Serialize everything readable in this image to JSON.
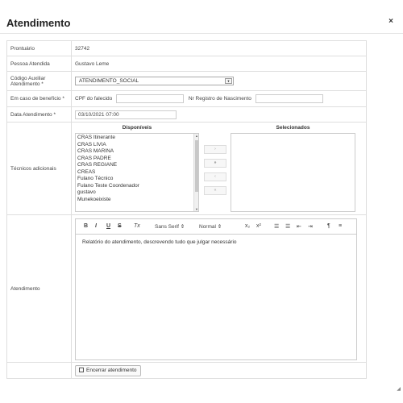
{
  "modal": {
    "title": "Atendimento",
    "close": "×"
  },
  "rows": {
    "prontuario": {
      "label": "Prontuário",
      "value": "32742"
    },
    "pessoa": {
      "label": "Pessoa Atendida",
      "value": "Gustavo Leme"
    },
    "codigo": {
      "label": "Código Auxiliar Atendimento *",
      "value": "ATENDIMENTO_SOCIAL"
    },
    "beneficio": {
      "label": "Em caso de benefício *",
      "cpf_label": "CPF do falecido",
      "cpf_value": "",
      "registro_label": "Nr Registro de Nascimento",
      "registro_value": ""
    },
    "data": {
      "label": "Data Atendimento *",
      "value": "03/10/2021 07:00"
    },
    "tecnicos": {
      "label": "Técnicos adicionais",
      "disponiveis_title": "Disponíveis",
      "selecionados_title": "Selecionados",
      "disponiveis": [
        "CRAS Itinerante",
        "CRAS LIVIA",
        "CRAS MARINA",
        "CRAS PADRE",
        "CRAS REGIANE",
        "CREAS",
        "Fulano Técnico",
        "Fulano Teste Coordenador",
        "gustavo",
        "Munekoeixiste"
      ],
      "selecionados": []
    },
    "atendimento": {
      "label": "Atendimento",
      "font": "Sans Serif",
      "size": "Normal",
      "content": "Relatório do atendimento, descrevendo tudo que julgar necessário"
    }
  },
  "toolbar": {
    "bold": "B",
    "italic": "I",
    "underline": "U",
    "strike": "S",
    "clean": "Tx",
    "sub": "x₂",
    "sup": "x²"
  },
  "footer": {
    "finish_label": "Encerrar atendimento"
  },
  "move_buttons": {
    "add": "›",
    "add_all": "»",
    "remove": "‹",
    "remove_all": "«"
  }
}
